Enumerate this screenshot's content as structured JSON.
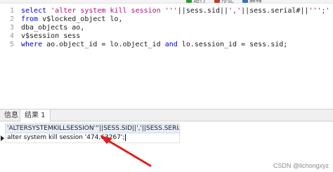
{
  "toolbar": {
    "run_label": "运行",
    "stop_label": "停止",
    "explain_label": "解释"
  },
  "editor": {
    "line_numbers": [
      "1",
      "2",
      "3",
      "4",
      "5"
    ],
    "lines": [
      {
        "parts": [
          {
            "text": "select ",
            "kind": "kw"
          },
          {
            "text": "'alter system kill session '''",
            "kind": "str"
          },
          {
            "text": "||sess.sid||",
            "kind": "plain"
          },
          {
            "text": "','",
            "kind": "str"
          },
          {
            "text": "||sess.serial#||",
            "kind": "plain"
          },
          {
            "text": "''';'",
            "kind": "str"
          }
        ]
      },
      {
        "parts": [
          {
            "text": "from ",
            "kind": "kw"
          },
          {
            "text": "v$locked_object lo,",
            "kind": "plain"
          }
        ]
      },
      {
        "parts": [
          {
            "text": "dba_objects ao,",
            "kind": "plain"
          }
        ]
      },
      {
        "parts": [
          {
            "text": "v$session sess",
            "kind": "plain"
          }
        ]
      },
      {
        "parts": [
          {
            "text": "where ",
            "kind": "kw"
          },
          {
            "text": "ao.object_id = lo.object_id ",
            "kind": "plain"
          },
          {
            "text": "and ",
            "kind": "kw"
          },
          {
            "text": "lo.session_id = sess.sid;",
            "kind": "plain"
          }
        ]
      }
    ]
  },
  "results": {
    "tabs": [
      {
        "label": "信息"
      },
      {
        "label": "结果 1"
      }
    ],
    "column_header": "'ALTERSYSTEMKILLSESSION'''||SESS.SID||','||SESS.SERIAL#||''';'",
    "rows": [
      "alter system kill session '474,63267';"
    ]
  },
  "annotation": {
    "arrow_color": "#e0201b"
  },
  "watermark": "CSDN @lichongxyz",
  "colors": {
    "keyword": "#0000d6",
    "string": "#b0107a",
    "header_bg": "#e8eef7"
  }
}
